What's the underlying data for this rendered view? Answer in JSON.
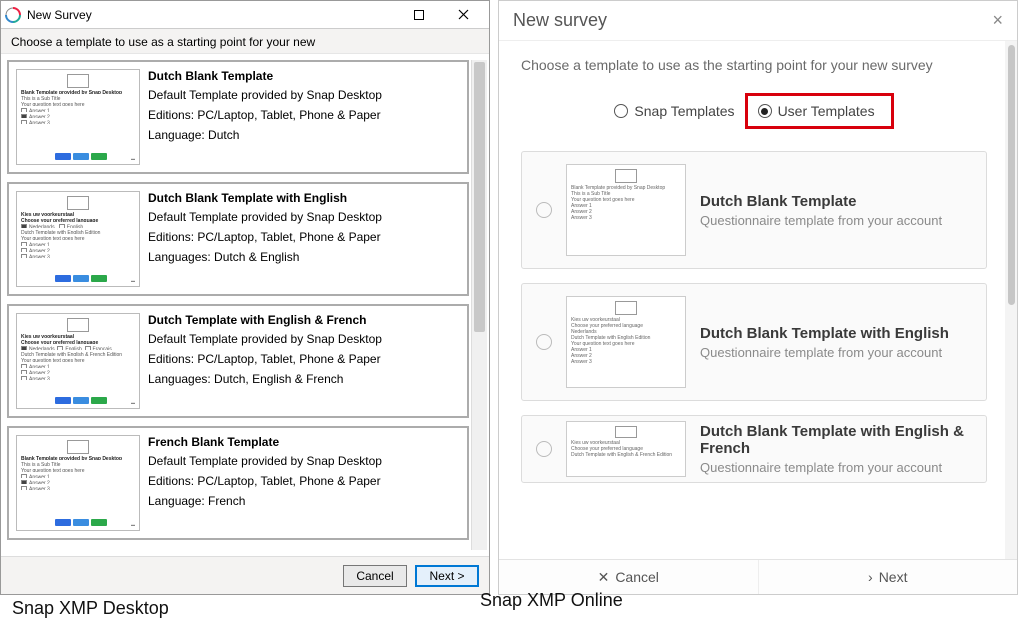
{
  "left": {
    "title": "New Survey",
    "instruction": "Choose a template to use as a starting point for your new",
    "items": [
      {
        "title": "Dutch Blank Template",
        "provider": "Default Template provided by Snap Desktop",
        "editions": "Editions: PC/Laptop, Tablet, Phone & Paper",
        "language": "Language: Dutch",
        "thumb_line1": "Blank Template provided by Snap Desktop",
        "thumb_line2": "This is a Sub Title",
        "thumb_line3": "Your question text goes here"
      },
      {
        "title": "Dutch Blank Template with English",
        "provider": "Default Template provided by Snap Desktop",
        "editions": "Editions: PC/Laptop, Tablet, Phone & Paper",
        "language": "Languages: Dutch & English",
        "thumb_line1": "Kies uw voorkeurstaal",
        "thumb_line1b": "Choose your preferred language",
        "thumb_line2": "Dutch Template with English Edition",
        "thumb_line3": "Your question text goes here"
      },
      {
        "title": "Dutch Template with English & French",
        "provider": "Default Template provided by Snap Desktop",
        "editions": "Editions: PC/Laptop, Tablet, Phone & Paper",
        "language": "Languages: Dutch, English & French",
        "thumb_line1": "Kies uw voorkeurstaal",
        "thumb_line1b": "Choose your preferred language",
        "thumb_line2": "Dutch Template with English & French Edition",
        "thumb_line3": "Your question text goes here"
      },
      {
        "title": "French Blank Template",
        "provider": "Default Template provided by Snap Desktop",
        "editions": "Editions: PC/Laptop, Tablet, Phone & Paper",
        "language": "Language: French",
        "thumb_line1": "Blank Template provided by Snap Desktop",
        "thumb_line2": "This is a Sub Title",
        "thumb_line3": "Your question text goes here"
      }
    ],
    "thumb_answer1": "Answer 1",
    "thumb_answer2": "Answer 2",
    "thumb_answer3": "Answer 3",
    "cancel": "Cancel",
    "next": "Next >"
  },
  "right": {
    "title": "New survey",
    "instruction": "Choose a template to use as the starting point for your new survey",
    "radio_snap": "Snap Templates",
    "radio_user": "User Templates",
    "items": [
      {
        "title": "Dutch Blank Template",
        "sub": "Questionnaire template from your account",
        "thumb_line1": "Blank Template provided by Snap Desktop",
        "thumb_line2": "This is a Sub Title",
        "thumb_line3": "Your question text goes here"
      },
      {
        "title": "Dutch Blank Template with English",
        "sub": "Questionnaire template from your account",
        "thumb_line1": "Kies uw voorkeurstaal",
        "thumb_line1b": "Choose your preferred language",
        "thumb_line2": "Dutch Template with English Edition",
        "thumb_line3": "Your question text goes here"
      },
      {
        "title": "Dutch Blank Template with English & French",
        "sub": "Questionnaire template from your account",
        "thumb_line1": "Kies uw voorkeurstaal",
        "thumb_line1b": "Choose your preferred language",
        "thumb_line2": "Dutch Template with English & French Edition"
      }
    ],
    "cancel": "Cancel",
    "next": "Next"
  },
  "captions": {
    "left": "Snap XMP Desktop",
    "right": "Snap XMP Online"
  }
}
